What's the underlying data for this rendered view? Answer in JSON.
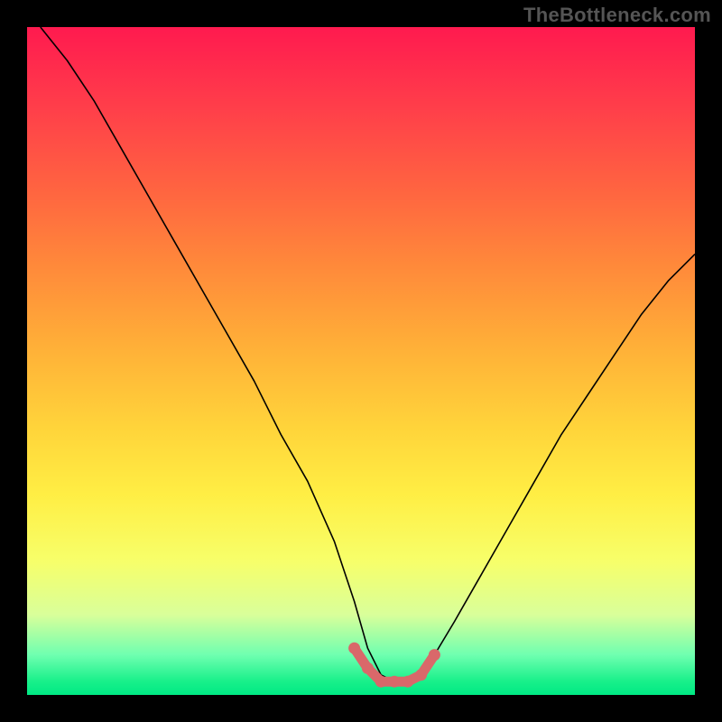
{
  "watermark": "TheBottleneck.com",
  "colors": {
    "page_bg": "#000000",
    "curve": "#000000",
    "throat": "#d9686a",
    "gradient_top": "#ff1a4f",
    "gradient_bottom": "#00e984"
  },
  "chart_data": {
    "type": "line",
    "title": "",
    "xlabel": "",
    "ylabel": "",
    "xlim": [
      0,
      100
    ],
    "ylim": [
      0,
      100
    ],
    "grid": false,
    "series": [
      {
        "name": "bottleneck-curve",
        "x": [
          2,
          6,
          10,
          14,
          18,
          22,
          26,
          30,
          34,
          38,
          42,
          46,
          49,
          51,
          53,
          55,
          57,
          59,
          61,
          64,
          68,
          72,
          76,
          80,
          84,
          88,
          92,
          96,
          100
        ],
        "values": [
          100,
          95,
          89,
          82,
          75,
          68,
          61,
          54,
          47,
          39,
          32,
          23,
          14,
          7,
          3,
          2,
          2,
          3,
          6,
          11,
          18,
          25,
          32,
          39,
          45,
          51,
          57,
          62,
          66
        ]
      }
    ],
    "throat_highlight": {
      "x": [
        49,
        51,
        53,
        55,
        57,
        59,
        61
      ],
      "values": [
        7,
        4,
        2,
        2,
        2,
        3,
        6
      ]
    }
  }
}
